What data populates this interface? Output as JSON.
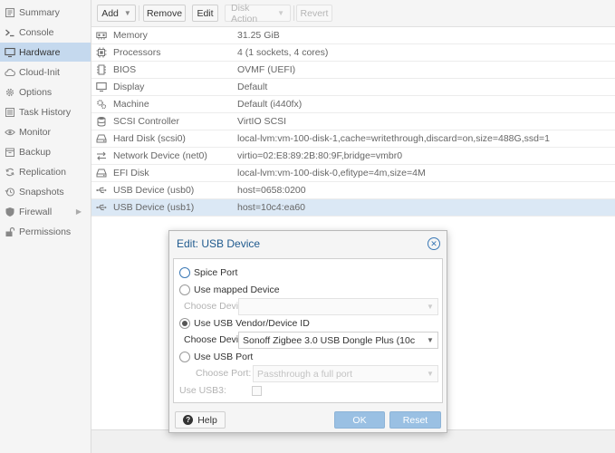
{
  "sidebar": {
    "items": [
      {
        "label": "Summary",
        "icon": "summary-icon"
      },
      {
        "label": "Console",
        "icon": "console-icon"
      },
      {
        "label": "Hardware",
        "icon": "monitor-icon",
        "active": true
      },
      {
        "label": "Cloud-Init",
        "icon": "cloud-icon"
      },
      {
        "label": "Options",
        "icon": "gear-icon"
      },
      {
        "label": "Task History",
        "icon": "list-icon"
      },
      {
        "label": "Monitor",
        "icon": "eye-icon"
      },
      {
        "label": "Backup",
        "icon": "backup-icon"
      },
      {
        "label": "Replication",
        "icon": "replication-icon"
      },
      {
        "label": "Snapshots",
        "icon": "history-icon"
      },
      {
        "label": "Firewall",
        "icon": "shield-icon",
        "has_submenu": true
      },
      {
        "label": "Permissions",
        "icon": "unlock-icon"
      }
    ]
  },
  "toolbar": {
    "add": "Add",
    "remove": "Remove",
    "edit": "Edit",
    "disk_action": "Disk Action",
    "revert": "Revert"
  },
  "hardware": {
    "rows": [
      {
        "name": "Memory",
        "value": "31.25 GiB",
        "icon": "memory-icon"
      },
      {
        "name": "Processors",
        "value": "4 (1 sockets, 4 cores)",
        "icon": "cpu-icon"
      },
      {
        "name": "BIOS",
        "value": "OVMF (UEFI)",
        "icon": "chip-icon"
      },
      {
        "name": "Display",
        "value": "Default",
        "icon": "display-icon"
      },
      {
        "name": "Machine",
        "value": "Default (i440fx)",
        "icon": "cogs-icon"
      },
      {
        "name": "SCSI Controller",
        "value": "VirtIO SCSI",
        "icon": "database-icon"
      },
      {
        "name": "Hard Disk (scsi0)",
        "value": "local-lvm:vm-100-disk-1,cache=writethrough,discard=on,size=488G,ssd=1",
        "icon": "hdd-icon"
      },
      {
        "name": "Network Device (net0)",
        "value": "virtio=02:E8:89:2B:80:9F,bridge=vmbr0",
        "icon": "exchange-icon"
      },
      {
        "name": "EFI Disk",
        "value": "local-lvm:vm-100-disk-0,efitype=4m,size=4M",
        "icon": "hdd-icon"
      },
      {
        "name": "USB Device (usb0)",
        "value": "host=0658:0200",
        "icon": "usb-icon"
      },
      {
        "name": "USB Device (usb1)",
        "value": "host=10c4:ea60",
        "icon": "usb-icon",
        "selected": true
      }
    ]
  },
  "dialog": {
    "title": "Edit: USB Device",
    "spice_port": "Spice Port",
    "use_mapped": "Use mapped Device",
    "choose_device_label": "Choose Device:",
    "mapped_device_value": "",
    "use_vendor": "Use USB Vendor/Device ID",
    "vendor_device_value": "Sonoff Zigbee 3.0 USB Dongle Plus (10c",
    "use_port": "Use USB Port",
    "choose_port_label": "Choose Port:",
    "port_placeholder": "Passthrough a full port",
    "use_usb3": "Use USB3:",
    "selected_option": "use_vendor",
    "help": "Help",
    "ok": "OK",
    "reset": "Reset"
  },
  "colors": {
    "accent": "#3a78b5",
    "selected_row": "#dbe8f5",
    "active_nav": "#c5d9ee",
    "primary_disabled": "#9ac0e3"
  }
}
